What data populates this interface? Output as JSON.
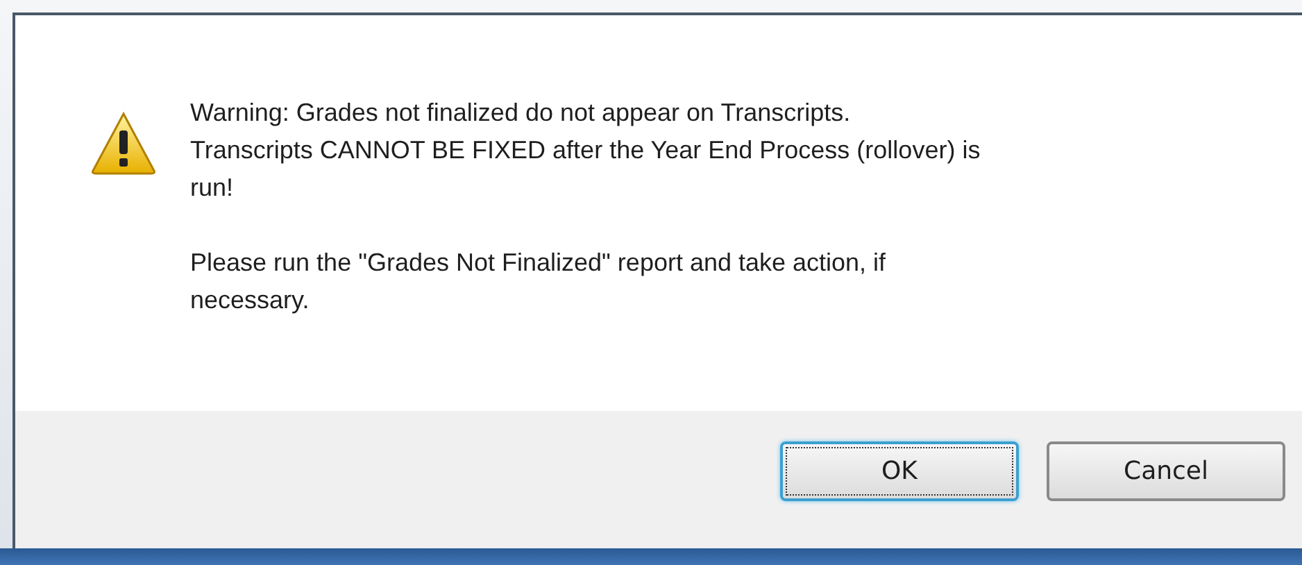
{
  "dialog": {
    "paragraphs": [
      "Warning: Grades not finalized do not appear on Transcripts.\nTranscripts CANNOT BE FIXED after the Year End Process (rollover) is\nrun!",
      "Please run the \"Grades Not Finalized\" report and take action, if\nnecessary."
    ],
    "buttons": [
      {
        "label": "OK",
        "focused": true
      },
      {
        "label": "Cancel",
        "focused": false
      }
    ]
  }
}
